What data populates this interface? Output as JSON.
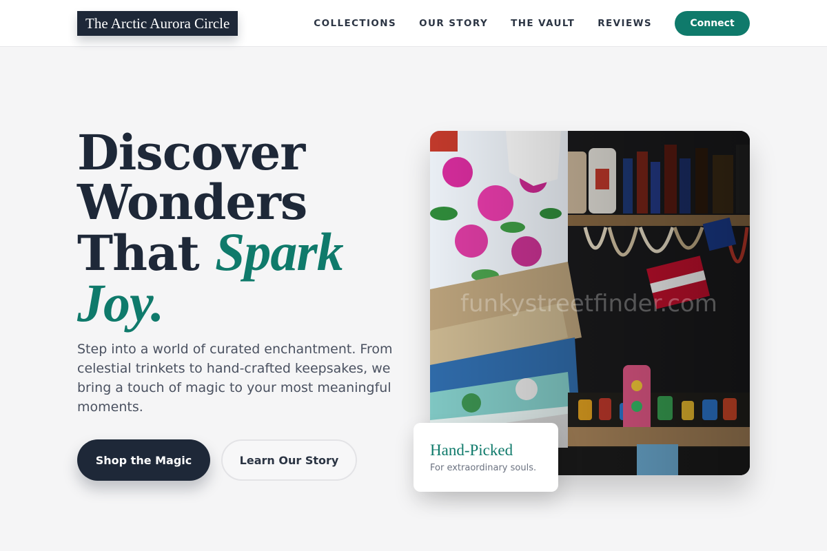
{
  "header": {
    "logo_text": "The Arctic Aurora Circle",
    "nav": [
      "COLLECTIONS",
      "OUR STORY",
      "THE VAULT",
      "REVIEWS"
    ],
    "connect_label": "Connect"
  },
  "hero": {
    "headline_line1": "Discover",
    "headline_line2": "Wonders",
    "headline_line3_plain": "That ",
    "headline_line3_accent": "Spark",
    "headline_line4_accent": "Joy.",
    "subtitle": "Step into a world of curated enchantment. From celestial trinkets to hand-crafted keepsakes, we bring a touch of magic to your most meaningful moments.",
    "primary_button": "Shop the Magic",
    "secondary_button": "Learn Our Story",
    "image_watermark": "funkystreetfinder.com"
  },
  "card": {
    "title": "Hand-Picked",
    "subtitle": "For extraordinary souls."
  },
  "colors": {
    "brand_dark": "#1e2838",
    "accent": "#0f7a6b",
    "background": "#f5f5f6"
  }
}
